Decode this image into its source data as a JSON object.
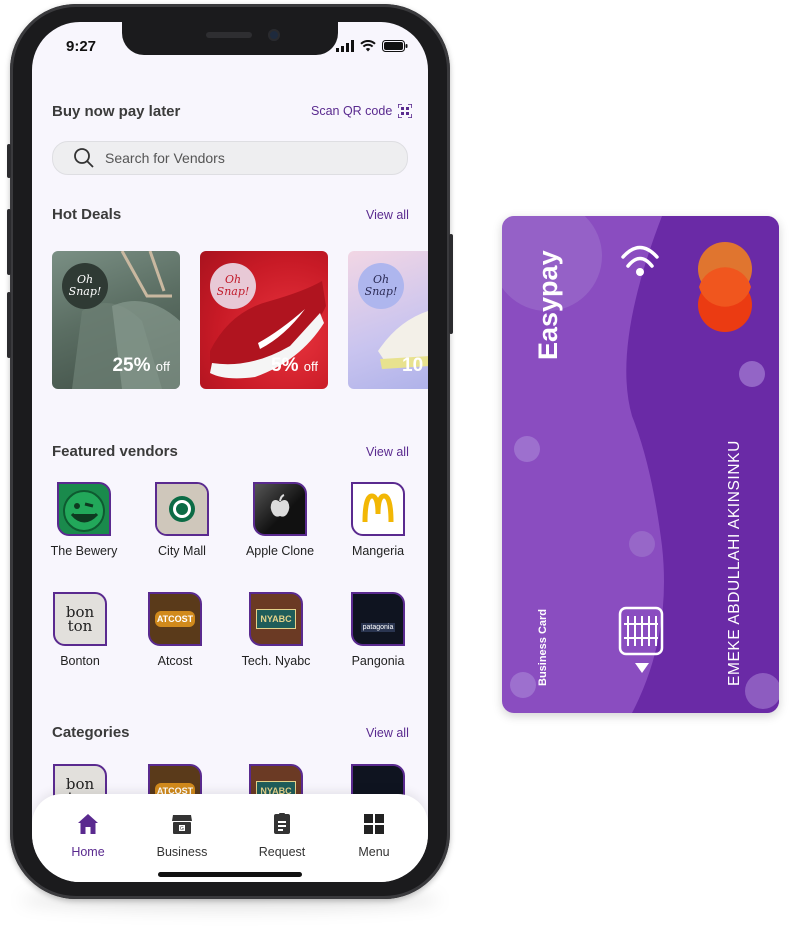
{
  "status": {
    "time": "9:27"
  },
  "header": {
    "title": "Buy now pay later",
    "scan_label": "Scan QR code"
  },
  "search": {
    "placeholder": "Search for Vendors"
  },
  "hot_deals": {
    "title": "Hot Deals",
    "view_all": "View all",
    "items": [
      {
        "badge": "Oh Snap!",
        "percent": "25%",
        "off": "off",
        "color": "#5a7a6a"
      },
      {
        "badge": "Oh Snap!",
        "percent": "5%",
        "off": "off",
        "color": "#d21f2b"
      },
      {
        "badge": "Oh Snap!",
        "percent": "10",
        "off": "",
        "color": "#b9b6e8"
      }
    ]
  },
  "featured": {
    "title": "Featured vendors",
    "view_all": "View all",
    "vendors": [
      {
        "name": "The Bewery",
        "logo": "smiley-logo"
      },
      {
        "name": "City Mall",
        "logo": "starbucks-logo"
      },
      {
        "name": "Apple Clone",
        "logo": "apple-logo"
      },
      {
        "name": "Mangeria",
        "logo": "mcdonalds-logo"
      },
      {
        "name": "Bonton",
        "logo": "bonton-logo",
        "text": "bon ton"
      },
      {
        "name": "Atcost",
        "logo": "atcost-logo",
        "text": "ATCOST"
      },
      {
        "name": "Tech. Nyabc",
        "logo": "nyabc-logo",
        "text": "NYABC"
      },
      {
        "name": "Pangonia",
        "logo": "patagonia-logo",
        "text": "patagonia"
      }
    ]
  },
  "categories": {
    "title": "Categories",
    "view_all": "View all"
  },
  "tabbar": {
    "items": [
      {
        "label": "Home",
        "icon": "home-icon",
        "active": true
      },
      {
        "label": "Business",
        "icon": "store-icon",
        "active": false
      },
      {
        "label": "Request",
        "icon": "document-icon",
        "active": false
      },
      {
        "label": "Menu",
        "icon": "grid-icon",
        "active": false
      }
    ]
  },
  "card": {
    "brand": "Easypay",
    "holder": "EMEKE ABDULLAHI  AKINSINKU",
    "type": "Business Card",
    "colors": {
      "base": "#8a4dc0",
      "dark": "#6a2aa6",
      "mc_red": "#eb3b12",
      "mc_orange": "#e0752f"
    }
  }
}
